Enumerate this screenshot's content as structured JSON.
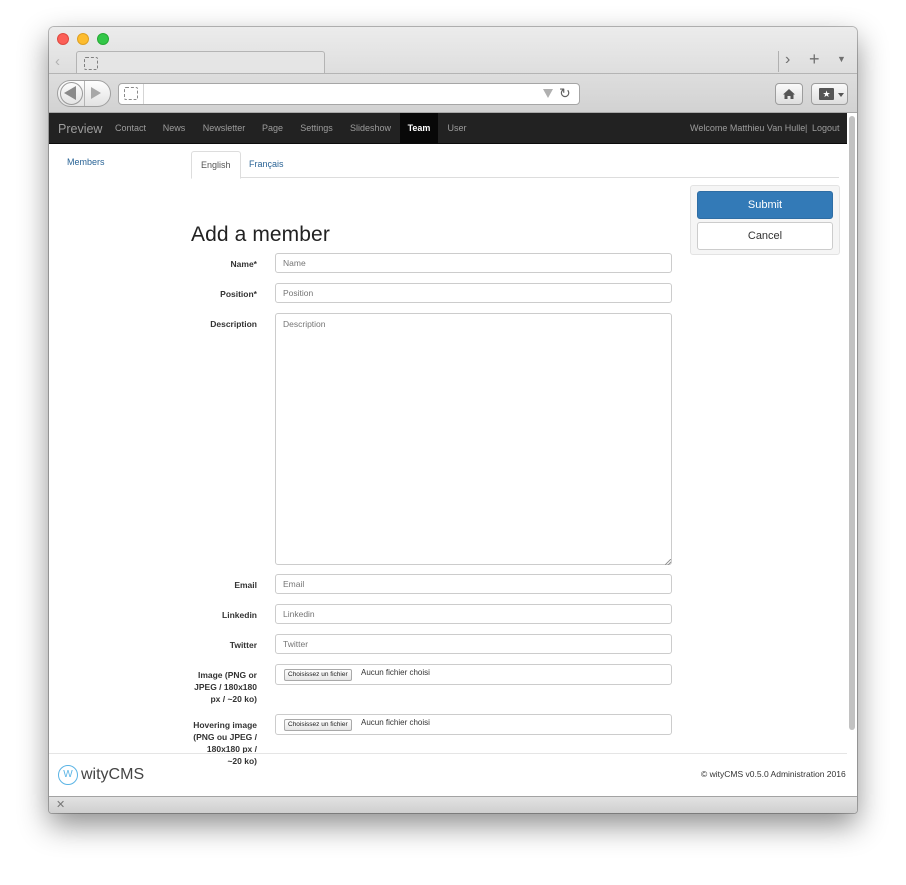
{
  "browser": {
    "tab_title": "",
    "url": ""
  },
  "navbar": {
    "brand": "Preview",
    "items": [
      "Contact",
      "News",
      "Newsletter",
      "Page",
      "Settings",
      "Slideshow",
      "Team",
      "User"
    ],
    "active_item": "Team",
    "welcome": "Welcome Matthieu Van Hulle",
    "separator": "|",
    "logout": "Logout"
  },
  "sidebar": {
    "members_link": "Members"
  },
  "lang_tabs": {
    "english": "English",
    "french": "Français"
  },
  "form": {
    "title": "Add a member",
    "name_label": "Name*",
    "name_placeholder": "Name",
    "position_label": "Position*",
    "position_placeholder": "Position",
    "description_label": "Description",
    "description_placeholder": "Description",
    "email_label": "Email",
    "email_placeholder": "Email",
    "linkedin_label": "Linkedin",
    "linkedin_placeholder": "Linkedin",
    "twitter_label": "Twitter",
    "twitter_placeholder": "Twitter",
    "image_label_lines": [
      "Image (PNG or",
      "JPEG / 180x180",
      "px / ~20 ko)"
    ],
    "hover_label_lines": [
      "Hovering image",
      "(PNG ou JPEG /",
      "180x180 px /",
      "~20 ko)"
    ],
    "file_button": "Choisissez un fichier",
    "file_status": "Aucun fichier choisi"
  },
  "actions": {
    "submit": "Submit",
    "cancel": "Cancel"
  },
  "footer": {
    "logo_text": "wityCMS",
    "copyright": "© wityCMS v0.5.0 Administration 2016"
  },
  "colors": {
    "navbar_bg": "#222222",
    "primary": "#337ab7",
    "link": "#2a6496"
  }
}
